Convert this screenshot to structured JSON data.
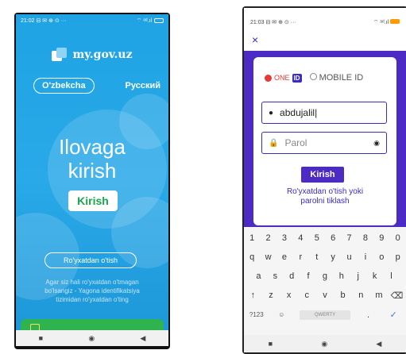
{
  "left": {
    "status_time": "21:02 ⊟ ✉ ⊕ ⊙ ···",
    "status_right": "⌔ ᵃᵈ.ıl",
    "logo_text": "my.gov.uz",
    "lang_uz": "O'zbekcha",
    "lang_ru": "Русский",
    "hero_line1": "Ilovaga",
    "hero_line2": "kirish",
    "login_button": "Kirish",
    "register_button": "Ro'yxatdan o'tish",
    "info_line1": "Agar siz hali ro'yxatdan o'tmagan",
    "info_line2": "bo'lsangiz - Yagona identifikatsiya",
    "info_line3": "tizimidan ro'yxatdan o'ting",
    "nav": [
      "■",
      "◉",
      "◀"
    ]
  },
  "right": {
    "status_time": "21:03 ⊟ ✉ ⊕ ⊙ ···",
    "status_right": "⌔ ᵃᵈ.ıl",
    "close": "×",
    "one_label": "ONE",
    "id_badge": "ID",
    "mobile_id": "MOBILE ID",
    "username_value": "abdujalil",
    "password_placeholder": "Parol",
    "login_button": "Kirish",
    "register_link_line1": "Ro'yxatdan o'tish yoki",
    "register_link_line2": "parolni tiklash",
    "keyboard": {
      "row_numbers": [
        "1",
        "2",
        "3",
        "4",
        "5",
        "6",
        "7",
        "8",
        "9",
        "0"
      ],
      "row1": [
        "q",
        "w",
        "e",
        "r",
        "t",
        "y",
        "u",
        "i",
        "o",
        "p"
      ],
      "row2": [
        "a",
        "s",
        "d",
        "f",
        "g",
        "h",
        "j",
        "k",
        "l"
      ],
      "row3": [
        "↑",
        "z",
        "x",
        "c",
        "v",
        "b",
        "n",
        "m",
        "⌫"
      ],
      "fn_key": "?123",
      "mic_key": "☺",
      "space_label": "QWERTY",
      "period_key": ".",
      "enter_key": "✓"
    },
    "nav": [
      "■",
      "◉",
      "◀"
    ]
  },
  "colors": {
    "left_bg": "#29a9e8",
    "green": "#1aa54d",
    "purple": "#4b2bc4",
    "red": "#e53935"
  }
}
